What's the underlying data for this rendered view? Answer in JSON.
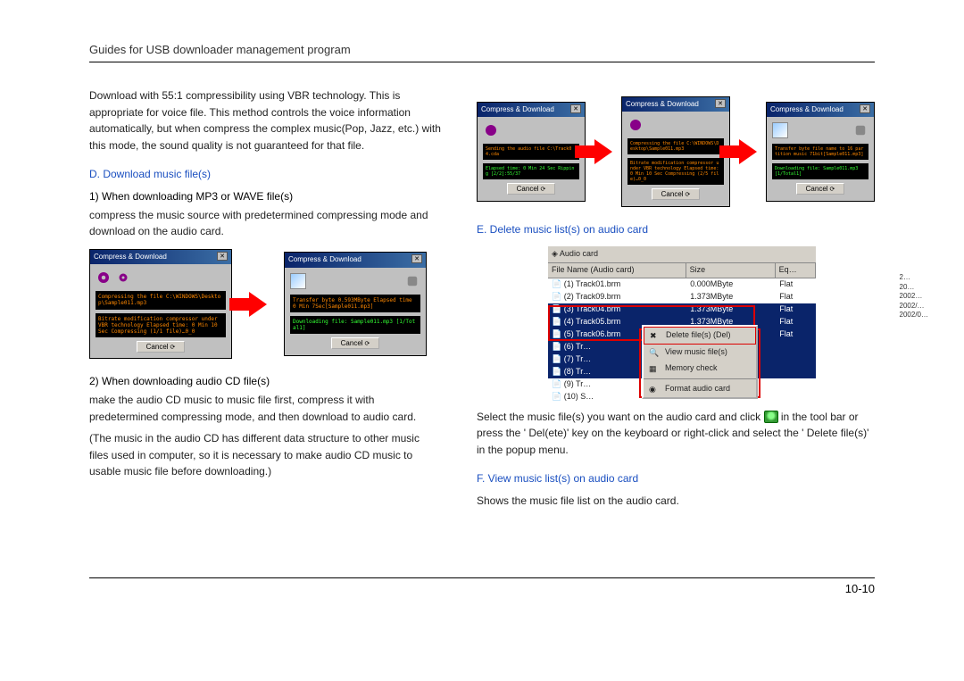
{
  "header": {
    "title": "Guides for USB downloader management program"
  },
  "left": {
    "intro": "Download with 55:1 compressibility using VBR technology. This is appropriate for voice file. This method controls the voice information automatically, but when compress the complex music(Pop, Jazz, etc.) with this mode, the sound quality is not guaranteed for that file.",
    "d_head": "D.  Download music file(s)",
    "d1_head": "1)  When downloading MP3 or WAVE file(s)",
    "d1_text": "compress the music source with predetermined compressing mode and  download on the audio card.",
    "d2_head": "2)  When downloading audio CD file(s)",
    "d2_text1": "make the audio CD music to music file first, compress it with predetermined compressing mode, and then download to audio card.",
    "d2_text2": "(The music in the audio CD has different data structure to other music files used in computer, so it is necessary to make audio CD music to usable music file before downloading.)"
  },
  "right": {
    "e_head": "E. Delete music list(s) on audio card",
    "e_text1_a": "Select the music file(s) you want on the audio card  and click ",
    "e_text1_b": " in the tool bar or press the ' Del(ete)'  key on the keyboard  or right-click and select the ' Delete file(s)'  in the popup menu.",
    "f_head": "F. View music list(s) on audio card",
    "f_text": "Shows the music file list on the audio card."
  },
  "dialog": {
    "title": "Compress & Download",
    "cancel": "Cancel",
    "box1a": "Compressing the file C:\\WINDOWS\\Desktop\\Sample011.mp3",
    "box1b": "Bitrate modification compressor under VBR technology Elapsed time: 0 Min 10 Sec Compressing (1/1 file)…0_0",
    "box2a": "Transfer byte 0.593MByte Elapsed time 0 Min 7Sec[Sample011.mp3]",
    "box2b": "Downloading file: Sample011.mp3 [1/Total1]",
    "box3a": "Sending the audio file C:\\Track04.cda",
    "box3b": "Elapsed time: 0 Min 24 Sec Ripping [2/2]:55/37",
    "box4a": "Compressing the file C:\\WINDOWS\\Desktop\\Sample011.mp3",
    "box4b": "Bitrate modification compressor under VBR technology Elapsed time: 0 Min 10 Sec Compressing (2/5 file)…0_0",
    "box5a": "Transfer byte file name to 16 partition music 71bit[Sample011.mp3]",
    "box5b": "Downloading file: Sample011.mp3 [1/Total1]"
  },
  "audio": {
    "card_label": "◈ Audio card",
    "cols": {
      "c1": "File Name (Audio card)",
      "c2": "Size",
      "c3": "Eq…"
    },
    "rows": [
      {
        "n": "(1) Track01.brm",
        "s": "0.000MByte",
        "e": "Flat",
        "sel": false
      },
      {
        "n": "(2) Track09.brm",
        "s": "1.373MByte",
        "e": "Flat",
        "sel": false
      },
      {
        "n": "(3) Track04.brm",
        "s": "1.373MByte",
        "e": "Flat",
        "sel": true
      },
      {
        "n": "(4) Track05.brm",
        "s": "1.373MByte",
        "e": "Flat",
        "sel": true
      },
      {
        "n": "(5) Track06.brm",
        "s": "1.373MByte",
        "e": "Flat",
        "sel": true
      },
      {
        "n": "(6) Tr…",
        "s": "",
        "e": "",
        "sel": true
      },
      {
        "n": "(7) Tr…",
        "s": "",
        "e": "",
        "sel": true
      },
      {
        "n": "(8) Tr…",
        "s": "",
        "e": "",
        "sel": true
      },
      {
        "n": "(9) Tr…",
        "s": "",
        "e": "",
        "sel": false
      },
      {
        "n": "(10) S…",
        "s": "",
        "e": "",
        "sel": false
      }
    ],
    "ctx": {
      "del": "Delete file(s)    (Del)",
      "view": "View music file(s)",
      "mem": "Memory check",
      "fmt": "Format audio card"
    },
    "years": [
      "2…",
      "20…",
      "2002…",
      "2002/…",
      "2002/0…"
    ]
  },
  "footer": {
    "page": "10-10"
  }
}
